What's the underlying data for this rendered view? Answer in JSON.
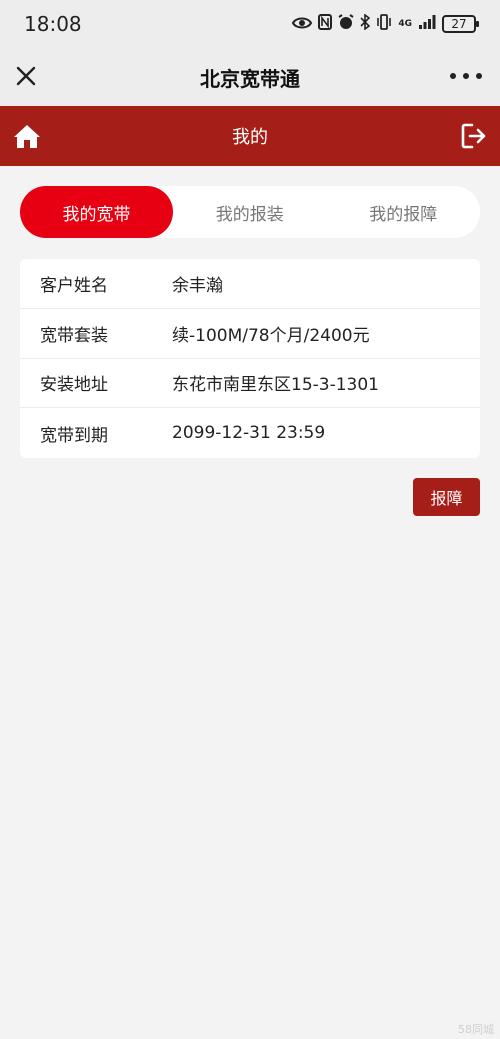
{
  "status_bar": {
    "time": "18:08",
    "network": "4G",
    "battery": "27"
  },
  "title_bar": {
    "title": "北京宽带通"
  },
  "header": {
    "title": "我的"
  },
  "tabs": [
    {
      "label": "我的宽带",
      "active": true
    },
    {
      "label": "我的报装",
      "active": false
    },
    {
      "label": "我的报障",
      "active": false
    }
  ],
  "info": [
    {
      "label": "客户姓名",
      "value": "余丰瀚"
    },
    {
      "label": "宽带套装",
      "value": "续-100M/78个月/2400元"
    },
    {
      "label": "安装地址",
      "value": "东花市南里东区15-3-1301"
    },
    {
      "label": "宽带到期",
      "value": "2099-12-31 23:59"
    }
  ],
  "actions": {
    "report_label": "报障"
  },
  "watermark": "58同城",
  "colors": {
    "header_bg": "#a51f18",
    "active_tab": "#e60012",
    "page_bg": "#f3f3f3"
  }
}
